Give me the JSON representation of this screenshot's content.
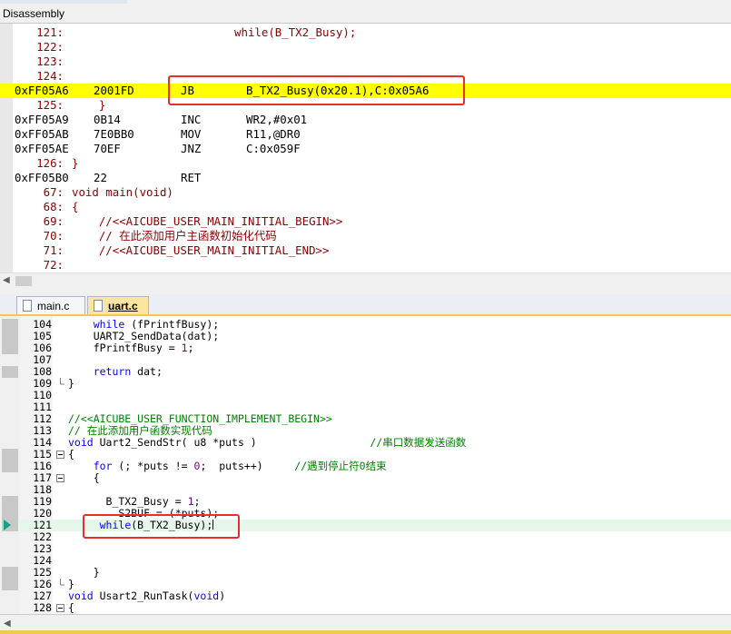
{
  "window": {
    "title": "Disassembly"
  },
  "disassembly": {
    "lines": [
      {
        "kind": "src",
        "num": "121:",
        "code": "                        while(B_TX2_Busy);"
      },
      {
        "kind": "src",
        "num": "122:",
        "code": ""
      },
      {
        "kind": "src",
        "num": "123:",
        "code": ""
      },
      {
        "kind": "src",
        "num": "124:",
        "code": ""
      },
      {
        "kind": "asm",
        "addr": "0xFF05A6",
        "bytes": "2001FD",
        "mnemonic": "JB",
        "operands": "B_TX2_Busy(0x20.1),C:0x05A6",
        "highlight": true
      },
      {
        "kind": "src",
        "num": "125:",
        "code": "    }"
      },
      {
        "kind": "asm",
        "addr": "0xFF05A9",
        "bytes": "0B14",
        "mnemonic": "INC",
        "operands": "WR2,#0x01"
      },
      {
        "kind": "asm",
        "addr": "0xFF05AB",
        "bytes": "7E0BB0",
        "mnemonic": "MOV",
        "operands": "R11,@DR0"
      },
      {
        "kind": "asm",
        "addr": "0xFF05AE",
        "bytes": "70EF",
        "mnemonic": "JNZ",
        "operands": "C:0x059F"
      },
      {
        "kind": "src",
        "num": "126:",
        "code": "}"
      },
      {
        "kind": "asm",
        "addr": "0xFF05B0",
        "bytes": "22",
        "mnemonic": "RET",
        "operands": ""
      },
      {
        "kind": "src",
        "num": "67:",
        "code": "void main(void)"
      },
      {
        "kind": "src",
        "num": "68:",
        "code": "{"
      },
      {
        "kind": "src",
        "num": "69:",
        "code": "    //<<AICUBE_USER_MAIN_INITIAL_BEGIN>>"
      },
      {
        "kind": "src",
        "num": "70:",
        "code": "    // 在此添加用户主函数初始化代码"
      },
      {
        "kind": "src",
        "num": "71:",
        "code": "    //<<AICUBE_USER_MAIN_INITIAL_END>>"
      },
      {
        "kind": "src",
        "num": "72:",
        "code": ""
      }
    ]
  },
  "tabs": [
    {
      "label": "main.c",
      "active": false
    },
    {
      "label": "uart.c",
      "active": true
    }
  ],
  "editor": {
    "current_line": "121",
    "lines": [
      {
        "num": "104",
        "bp": true,
        "fold": "",
        "tokens": [
          [
            "tx",
            "    "
          ],
          [
            "kw",
            "while"
          ],
          [
            "tx",
            " (fPrintfBusy);"
          ]
        ]
      },
      {
        "num": "105",
        "bp": true,
        "fold": "",
        "tokens": [
          [
            "tx",
            "    UART2_SendData(dat);"
          ]
        ]
      },
      {
        "num": "106",
        "bp": true,
        "fold": "",
        "tokens": [
          [
            "tx",
            "    fPrintfBusy = "
          ],
          [
            "num",
            "1"
          ],
          [
            "tx",
            ";"
          ]
        ]
      },
      {
        "num": "107",
        "bp": false,
        "fold": "",
        "tokens": []
      },
      {
        "num": "108",
        "bp": true,
        "fold": "",
        "tokens": [
          [
            "tx",
            "    "
          ],
          [
            "kw",
            "return"
          ],
          [
            "tx",
            " dat;"
          ]
        ]
      },
      {
        "num": "109",
        "bp": false,
        "fold": "end",
        "tokens": [
          [
            "tx",
            "}"
          ]
        ]
      },
      {
        "num": "110",
        "bp": false,
        "fold": "",
        "tokens": []
      },
      {
        "num": "111",
        "bp": false,
        "fold": "",
        "tokens": []
      },
      {
        "num": "112",
        "bp": false,
        "fold": "",
        "tokens": [
          [
            "cm",
            "//<<AICUBE_USER_FUNCTION_IMPLEMENT_BEGIN>>"
          ]
        ]
      },
      {
        "num": "113",
        "bp": false,
        "fold": "",
        "tokens": [
          [
            "cm",
            "// 在此添加用户函数实现代码"
          ]
        ]
      },
      {
        "num": "114",
        "bp": false,
        "fold": "",
        "tokens": [
          [
            "kw",
            "void"
          ],
          [
            "tx",
            " Uart2_SendStr( u8 *puts )                  "
          ],
          [
            "cm",
            "//串口数据发送函数"
          ]
        ]
      },
      {
        "num": "115",
        "bp": true,
        "fold": "open",
        "tokens": [
          [
            "tx",
            "{"
          ]
        ]
      },
      {
        "num": "116",
        "bp": true,
        "fold": "",
        "tokens": [
          [
            "tx",
            "    "
          ],
          [
            "kw",
            "for"
          ],
          [
            "tx",
            " (; *puts != "
          ],
          [
            "num",
            "0"
          ],
          [
            "tx",
            ";  puts++)     "
          ],
          [
            "cm",
            "//遇到停止符0结束"
          ]
        ]
      },
      {
        "num": "117",
        "bp": false,
        "fold": "open",
        "tokens": [
          [
            "tx",
            "    {"
          ]
        ]
      },
      {
        "num": "118",
        "bp": false,
        "fold": "",
        "tokens": []
      },
      {
        "num": "119",
        "bp": true,
        "fold": "",
        "tokens": [
          [
            "tx",
            "      B_TX2_Busy = "
          ],
          [
            "num",
            "1"
          ],
          [
            "tx",
            ";"
          ]
        ]
      },
      {
        "num": "120",
        "bp": true,
        "fold": "",
        "tokens": [
          [
            "tx",
            "        S2BUF = (*puts);"
          ]
        ]
      },
      {
        "num": "121",
        "bp": true,
        "fold": "",
        "current": true,
        "caret": true,
        "tokens": [
          [
            "tx",
            "     "
          ],
          [
            "kw",
            "while"
          ],
          [
            "tx",
            "(B_TX2_Busy);"
          ]
        ]
      },
      {
        "num": "122",
        "bp": false,
        "fold": "",
        "tokens": []
      },
      {
        "num": "123",
        "bp": false,
        "fold": "",
        "tokens": []
      },
      {
        "num": "124",
        "bp": false,
        "fold": "",
        "tokens": []
      },
      {
        "num": "125",
        "bp": true,
        "fold": "",
        "tokens": [
          [
            "tx",
            "    }"
          ]
        ]
      },
      {
        "num": "126",
        "bp": true,
        "fold": "end",
        "tokens": [
          [
            "tx",
            "}"
          ]
        ]
      },
      {
        "num": "127",
        "bp": false,
        "fold": "",
        "tokens": [
          [
            "kw",
            "void"
          ],
          [
            "tx",
            " Usart2_RunTask("
          ],
          [
            "kw",
            "void"
          ],
          [
            "tx",
            ")"
          ]
        ]
      },
      {
        "num": "128",
        "bp": false,
        "fold": "open",
        "tokens": [
          [
            "tx",
            "{"
          ]
        ]
      }
    ]
  }
}
